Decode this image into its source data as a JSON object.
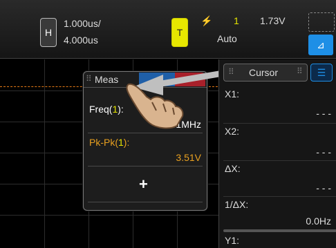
{
  "horizontal": {
    "button_label": "H",
    "timebase_scale": "1.000us/",
    "timebase_delay": "4.000us"
  },
  "trigger": {
    "button_label": "T",
    "slope_icon": "rising-edge-icon",
    "source": "1",
    "level": "1.73V",
    "mode": "Auto"
  },
  "meas_panel": {
    "title": "Meas",
    "close_label": "×",
    "items": [
      {
        "label": "Freq(",
        "channel": "1",
        "label_end": "):",
        "value": "3.331MHz",
        "color": "#ffffff"
      },
      {
        "label": "Pk-Pk(",
        "channel": "1",
        "label_end": "):",
        "value": "3.51V",
        "color": "#e8a020"
      }
    ],
    "add_label": "+"
  },
  "cursor_panel": {
    "title": "Cursor",
    "rows": [
      {
        "label": "X1:",
        "value": "- - -"
      },
      {
        "label": "X2:",
        "value": "- - -"
      },
      {
        "label": "ΔX:",
        "value": "- - -"
      },
      {
        "label": "1/ΔX:",
        "value": "0.0Hz"
      },
      {
        "label": "Y1:",
        "value": ""
      }
    ]
  },
  "colors": {
    "channel1": "#e6e600",
    "trace": "#e87b16",
    "accent": "#1e8fe6"
  }
}
